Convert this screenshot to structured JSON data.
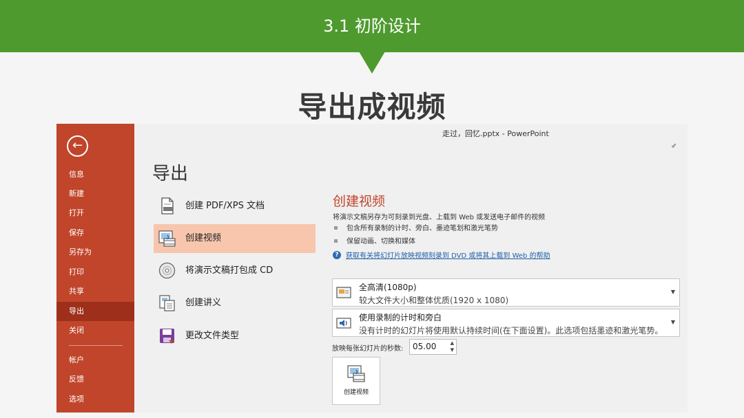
{
  "slide": {
    "banner_title": "3.1 初阶设计",
    "title": "导出成视频"
  },
  "window": {
    "title": "走过，回忆.pptx - PowerPoint"
  },
  "backstage": {
    "back_icon": "back-arrow-icon",
    "items": [
      "信息",
      "新建",
      "打开",
      "保存",
      "另存为",
      "打印",
      "共享",
      "导出",
      "关闭"
    ],
    "bottom_items": [
      "帐户",
      "反馈",
      "选项"
    ],
    "active": "导出"
  },
  "export": {
    "heading": "导出",
    "options": [
      {
        "label": "创建 PDF/XPS 文档",
        "icon": "pdf-document-icon"
      },
      {
        "label": "创建视频",
        "icon": "create-video-icon"
      },
      {
        "label": "将演示文稿打包成 CD",
        "icon": "cd-disc-icon"
      },
      {
        "label": "创建讲义",
        "icon": "handout-icon"
      },
      {
        "label": "更改文件类型",
        "icon": "change-filetype-icon"
      }
    ],
    "active_option": "创建视频"
  },
  "video": {
    "heading": "创建视频",
    "description": "将演示文稿另存为可刻录到光盘、上载到 Web 或发送电子邮件的视频",
    "bullets": [
      "包含所有录制的计时、旁白、墨迹笔划和激光笔势",
      "保留动画、切换和媒体"
    ],
    "help_link": "获取有关将幻灯片放映视频刻录到 DVD 或将其上载到 Web 的帮助",
    "quality": {
      "main": "全高清(1080p)",
      "sub": "较大文件大小和整体优质(1920 x 1080)"
    },
    "timing": {
      "main": "使用录制的计时和旁白",
      "sub": "没有计时的幻灯片将使用默认持续时间(在下面设置)。此选项包括墨迹和激光笔势。"
    },
    "seconds_label": "放映每张幻灯片的秒数:",
    "seconds_value": "05.00",
    "create_button": "创建视频"
  },
  "colors": {
    "banner": "#4f9a2f",
    "backstage": "#c0452a",
    "active_nav": "#9e2f1b",
    "active_option": "#f7c6ad",
    "accent_heading": "#c0452a",
    "link": "#1f5ea8"
  }
}
